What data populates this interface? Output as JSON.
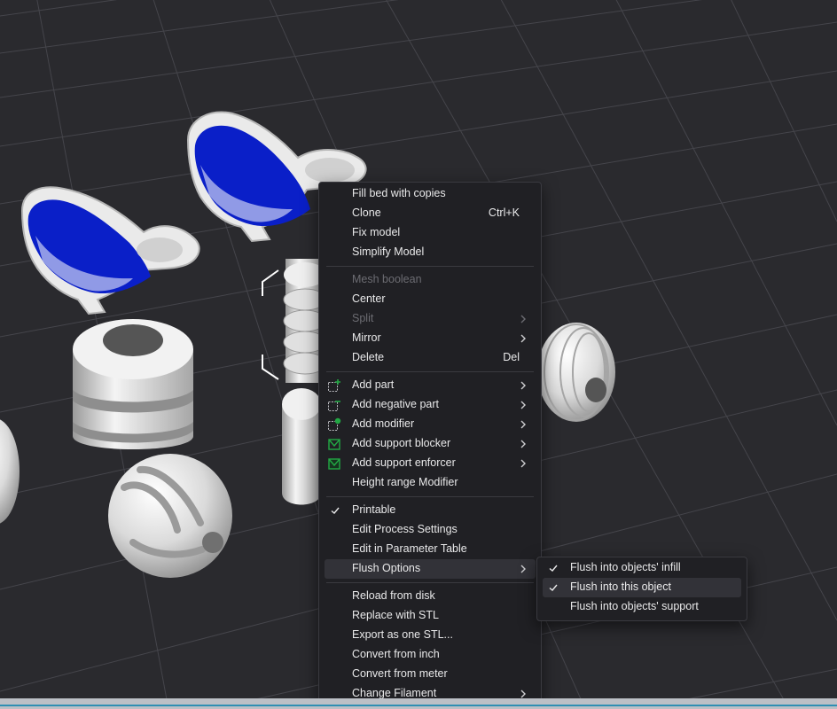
{
  "context_menu": {
    "fill_bed": "Fill bed with copies",
    "clone": "Clone",
    "clone_shortcut": "Ctrl+K",
    "fix_model": "Fix model",
    "simplify_model": "Simplify Model",
    "mesh_boolean": "Mesh boolean",
    "center": "Center",
    "split": "Split",
    "mirror": "Mirror",
    "delete": "Delete",
    "delete_shortcut": "Del",
    "add_part": "Add part",
    "add_negative_part": "Add negative part",
    "add_modifier": "Add modifier",
    "add_support_blocker": "Add support blocker",
    "add_support_enforcer": "Add support enforcer",
    "height_range_modifier": "Height range Modifier",
    "printable": "Printable",
    "edit_process_settings": "Edit Process Settings",
    "edit_in_parameter_table": "Edit in Parameter Table",
    "flush_options": "Flush Options",
    "reload_from_disk": "Reload from disk",
    "replace_with_stl": "Replace with STL",
    "export_as_one_stl": "Export as one STL...",
    "convert_from_inch": "Convert from inch",
    "convert_from_meter": "Convert from meter",
    "change_filament": "Change Filament"
  },
  "flush_submenu": {
    "infill": "Flush into objects' infill",
    "this_object": "Flush into this object",
    "support": "Flush into objects' support"
  },
  "state": {
    "printable_checked": true,
    "flush_infill_checked": true,
    "flush_this_object_checked": true,
    "flush_support_checked": false,
    "disabled_items": [
      "mesh_boolean",
      "split"
    ],
    "highlighted_items": [
      "flush_options",
      "flush_into_this_object"
    ]
  },
  "scene_objects": [
    "whale-model",
    "whale-model",
    "ribbed-cylinder",
    "ringed-cylinder",
    "ringed-sphere",
    "ribbed-sphere",
    "grooved-sphere",
    "sphere"
  ],
  "colors": {
    "viewport_bg": "#2a2a2e",
    "grid_line": "#45454b",
    "menu_bg": "#202024",
    "menu_highlight": "#323238",
    "text": "#e9e9ea",
    "text_disabled": "#6c6c72",
    "accent_green": "#22a844",
    "whale_blue": "#0a1fc8",
    "model_white": "#e3e3e3"
  }
}
